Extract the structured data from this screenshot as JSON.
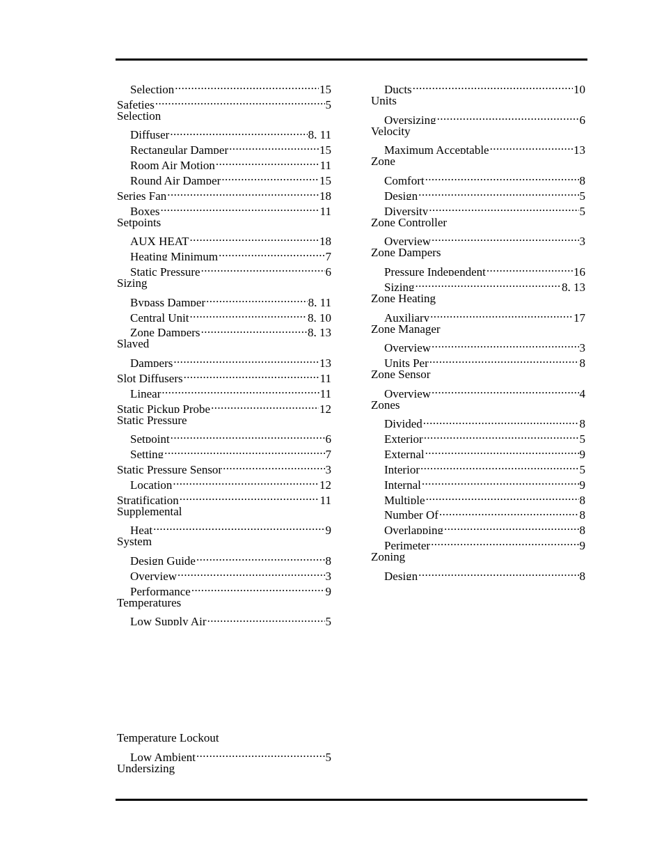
{
  "left_column": [
    {
      "term": "Selection",
      "page": "15",
      "level": 1
    },
    {
      "term": "Safeties",
      "page": "5",
      "level": 0
    },
    {
      "term": "Selection",
      "page": "",
      "level": 0
    },
    {
      "term": "Diffuser",
      "page": "8, 11",
      "level": 1
    },
    {
      "term": "Rectangular Damper",
      "page": "15",
      "level": 1
    },
    {
      "term": "Room Air Motion",
      "page": "11",
      "level": 1
    },
    {
      "term": "Round Air Damper",
      "page": "15",
      "level": 1
    },
    {
      "term": "Series Fan",
      "page": "18",
      "level": 0
    },
    {
      "term": "Boxes",
      "page": "11",
      "level": 1
    },
    {
      "term": "Setpoints",
      "page": "",
      "level": 0
    },
    {
      "term": "AUX HEAT",
      "page": "18",
      "level": 1
    },
    {
      "term": "Heating Minimum",
      "page": "7",
      "level": 1
    },
    {
      "term": "Static Pressure",
      "page": "6",
      "level": 1
    },
    {
      "term": "Sizing",
      "page": "",
      "level": 0
    },
    {
      "term": "Bypass Damper",
      "page": "8, 11",
      "level": 1
    },
    {
      "term": "Central Unit",
      "page": "8, 10",
      "level": 1
    },
    {
      "term": "Zone Dampers",
      "page": "8, 13",
      "level": 1
    },
    {
      "term": "Slaved",
      "page": "",
      "level": 0
    },
    {
      "term": "Dampers",
      "page": "13",
      "level": 1
    },
    {
      "term": "Slot Diffusers",
      "page": "11",
      "level": 0
    },
    {
      "term": "Linear",
      "page": "11",
      "level": 1
    },
    {
      "term": "Static Pickup Probe",
      "page": "12",
      "level": 0
    },
    {
      "term": "Static Pressure",
      "page": "",
      "level": 0
    },
    {
      "term": "Setpoint",
      "page": "6",
      "level": 1
    },
    {
      "term": "Setting",
      "page": "7",
      "level": 1
    },
    {
      "term": "Static Pressure Sensor",
      "page": "3",
      "level": 0
    },
    {
      "term": "Location",
      "page": "12",
      "level": 1
    },
    {
      "term": "Stratification",
      "page": "11",
      "level": 0
    },
    {
      "term": "Supplemental",
      "page": "",
      "level": 0
    },
    {
      "term": "Heat",
      "page": "9",
      "level": 1
    },
    {
      "term": "System",
      "page": "",
      "level": 0
    },
    {
      "term": "Design Guide",
      "page": "8",
      "level": 1
    },
    {
      "term": "Overview",
      "page": "3",
      "level": 1
    },
    {
      "term": "Performance",
      "page": "9",
      "level": 1
    },
    {
      "term": "Temperatures",
      "page": "",
      "level": 0
    },
    {
      "term": "Low Supply Air",
      "page": "5",
      "level": 1
    }
  ],
  "left_column_bottom": [
    {
      "term": "Temperature Lockout",
      "page": "",
      "level": 0
    },
    {
      "term": "Low Ambient",
      "page": "5",
      "level": 1
    },
    {
      "term": "Undersizing",
      "page": "",
      "level": 0
    }
  ],
  "right_column": [
    {
      "term": "Ducts",
      "page": "10",
      "level": 1
    },
    {
      "term": "Units",
      "page": "",
      "level": 0
    },
    {
      "term": "Oversizing",
      "page": "6",
      "level": 1
    },
    {
      "term": "Velocity",
      "page": "",
      "level": 0
    },
    {
      "term": "Maximum Acceptable",
      "page": "13",
      "level": 1
    },
    {
      "term": "Zone",
      "page": "",
      "level": 0
    },
    {
      "term": "Comfort",
      "page": "8",
      "level": 1
    },
    {
      "term": "Design",
      "page": "5",
      "level": 1
    },
    {
      "term": "Diversity",
      "page": "5",
      "level": 1
    },
    {
      "term": "Zone Controller",
      "page": "",
      "level": 0
    },
    {
      "term": "Overview",
      "page": "3",
      "level": 1
    },
    {
      "term": "Zone Dampers",
      "page": "",
      "level": 0
    },
    {
      "term": "Pressure Independent",
      "page": "16",
      "level": 1
    },
    {
      "term": "Sizing",
      "page": "8, 13",
      "level": 1
    },
    {
      "term": "Zone Heating",
      "page": "",
      "level": 0
    },
    {
      "term": "Auxiliary",
      "page": "17",
      "level": 1
    },
    {
      "term": "Zone Manager",
      "page": "",
      "level": 0
    },
    {
      "term": "Overview",
      "page": "3",
      "level": 1
    },
    {
      "term": "Units Per",
      "page": "8",
      "level": 1
    },
    {
      "term": "Zone Sensor",
      "page": "",
      "level": 0
    },
    {
      "term": "Overview",
      "page": "4",
      "level": 1
    },
    {
      "term": "Zones",
      "page": "",
      "level": 0
    },
    {
      "term": "Divided",
      "page": "8",
      "level": 1
    },
    {
      "term": "Exterior",
      "page": "5",
      "level": 1
    },
    {
      "term": "External",
      "page": "9",
      "level": 1
    },
    {
      "term": "Interior",
      "page": "5",
      "level": 1
    },
    {
      "term": "Internal",
      "page": "9",
      "level": 1
    },
    {
      "term": "Multiple",
      "page": "8",
      "level": 1
    },
    {
      "term": "Number Of",
      "page": "8",
      "level": 1
    },
    {
      "term": "Overlapping",
      "page": "8",
      "level": 1
    },
    {
      "term": "Perimeter",
      "page": "9",
      "level": 1
    },
    {
      "term": "Zoning",
      "page": "",
      "level": 0
    },
    {
      "term": "Design",
      "page": "8",
      "level": 1
    }
  ]
}
